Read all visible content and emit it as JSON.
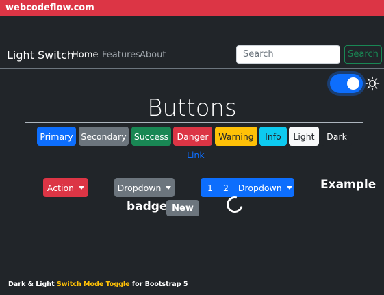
{
  "watermark": "webcodeflow.com",
  "navbar": {
    "brand": "Light Switch",
    "links": [
      "Home",
      "Features",
      "About"
    ],
    "search_placeholder": "Search",
    "search_button": "Search"
  },
  "theme_switch": {
    "on": true,
    "icon": "sun-icon"
  },
  "heading": "Buttons",
  "buttons": {
    "primary": "Primary",
    "secondary": "Secondary",
    "success": "Success",
    "danger": "Danger",
    "warning": "Warning",
    "info": "Info",
    "light": "Light",
    "dark": "Dark",
    "link": "Link"
  },
  "dropdowns": {
    "action": "Action",
    "dropdown": "Dropdown",
    "group_1": "1",
    "group_2": "2",
    "group_dropdown": "Dropdown"
  },
  "example": "Example",
  "badge": {
    "text": "badge",
    "label": "New"
  },
  "footer": {
    "part1": "Dark & Light ",
    "highlight": "Switch Mode Toggle",
    "part2": " for Bootstrap 5"
  },
  "colors": {
    "background": "#212529",
    "primary": "#0d6efd",
    "secondary": "#6c757d",
    "success": "#198754",
    "danger": "#dc3545",
    "warning": "#ffc107",
    "info": "#0dcaf0",
    "light": "#f8f9fa"
  }
}
